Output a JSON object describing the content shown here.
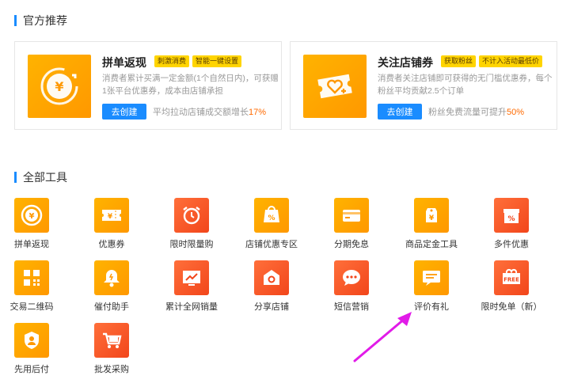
{
  "recommended": {
    "title": "官方推荐",
    "cards": [
      {
        "name": "拼单返现",
        "tags": [
          "刺激消费",
          "智能一键设置"
        ],
        "desc": "消费者累计买满一定金额(1个自然日内)，可获赠1张平台优惠券，成本由店铺承担",
        "button": "去创建",
        "stat_text": "平均拉动店铺成交额增长",
        "stat_value": "17%",
        "icon": "yuan-refund-icon"
      },
      {
        "name": "关注店铺券",
        "tags": [
          "获取粉丝",
          "不计入活动最低价"
        ],
        "desc": "消费者关注店铺即可获得的无门槛优惠券，每个粉丝平均贡献2.5个订单",
        "button": "去创建",
        "stat_text": "粉丝免费流量可提升",
        "stat_value": "50%",
        "icon": "heart-ticket-icon"
      }
    ]
  },
  "all_tools": {
    "title": "全部工具",
    "items": [
      {
        "label": "拼单返现",
        "icon": "yuan-circle-icon",
        "color": "orange"
      },
      {
        "label": "优惠券",
        "icon": "coupon-icon",
        "color": "orange"
      },
      {
        "label": "限时限量购",
        "icon": "alarm-clock-icon",
        "color": "red"
      },
      {
        "label": "店铺优惠专区",
        "icon": "discount-bag-icon",
        "color": "orange"
      },
      {
        "label": "分期免息",
        "icon": "credit-card-icon",
        "color": "orange"
      },
      {
        "label": "商品定金工具",
        "icon": "price-tag-icon",
        "color": "orange"
      },
      {
        "label": "多件优惠",
        "icon": "discount-box-icon",
        "color": "red"
      },
      {
        "label": "交易二维码",
        "icon": "qr-code-icon",
        "color": "orange"
      },
      {
        "label": "催付助手",
        "icon": "bell-icon",
        "color": "orange"
      },
      {
        "label": "累计全网销量",
        "icon": "trend-chart-icon",
        "color": "red"
      },
      {
        "label": "分享店铺",
        "icon": "store-icon",
        "color": "red"
      },
      {
        "label": "短信营销",
        "icon": "chat-bubble-icon",
        "color": "red"
      },
      {
        "label": "评价有礼",
        "icon": "comment-icon",
        "color": "orange"
      },
      {
        "label": "限时免单（新）",
        "icon": "free-badge-icon",
        "color": "red"
      },
      {
        "label": "先用后付",
        "icon": "shield-user-icon",
        "color": "orange"
      },
      {
        "label": "批发采购",
        "icon": "cart-icon",
        "color": "red"
      }
    ]
  },
  "colors": {
    "accent": "#1a8cff",
    "highlight": "#ff6a00",
    "arrow": "#e11be8"
  }
}
